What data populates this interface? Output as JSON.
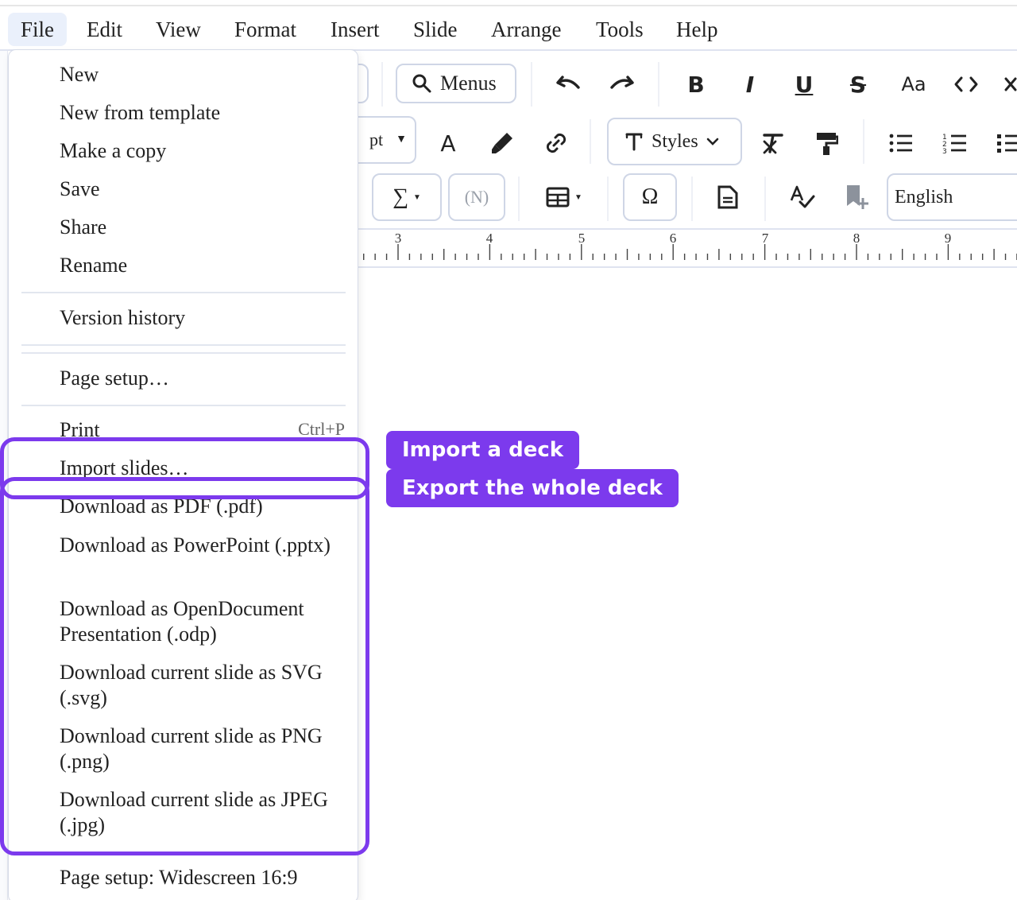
{
  "menubar": {
    "items": [
      "File",
      "Edit",
      "View",
      "Format",
      "Insert",
      "Slide",
      "Arrange",
      "Tools",
      "Help"
    ],
    "active": "File"
  },
  "toolbar": {
    "menus_label": "Menus",
    "font_size_partial": "pt",
    "styles_label": "Styles",
    "sum_symbol": "∑",
    "field_label": "(N)",
    "omega_symbol": "Ω",
    "case_label": "Aa",
    "language_value": "English"
  },
  "ruler": {
    "numbers": [
      "3",
      "4",
      "5",
      "6",
      "7",
      "8",
      "9"
    ]
  },
  "file_menu": {
    "new": "New",
    "new_from_template": "New from template",
    "make_a_copy": "Make a copy",
    "save": "Save",
    "share": "Share",
    "rename": "Rename",
    "version_history": "Version history",
    "page_setup": "Page setup…",
    "print": "Print",
    "print_shortcut": "Ctrl+P",
    "import_slides": "Import slides…",
    "download_pdf": "Download as PDF (.pdf)",
    "download_pptx": "Download as PowerPoint (.pptx)",
    "download_odp": "Download as OpenDocument Presentation (.odp)",
    "download_svg": "Download current slide as SVG (.svg)",
    "download_png": "Download current slide as PNG (.png)",
    "download_jpg": "Download current slide as JPEG (.jpg)",
    "page_setup_status": "Page setup: Widescreen 16:9"
  },
  "annotations": {
    "import_callout": "Import a deck",
    "export_callout": "Export the whole deck",
    "highlight_color": "#7c3aed"
  }
}
